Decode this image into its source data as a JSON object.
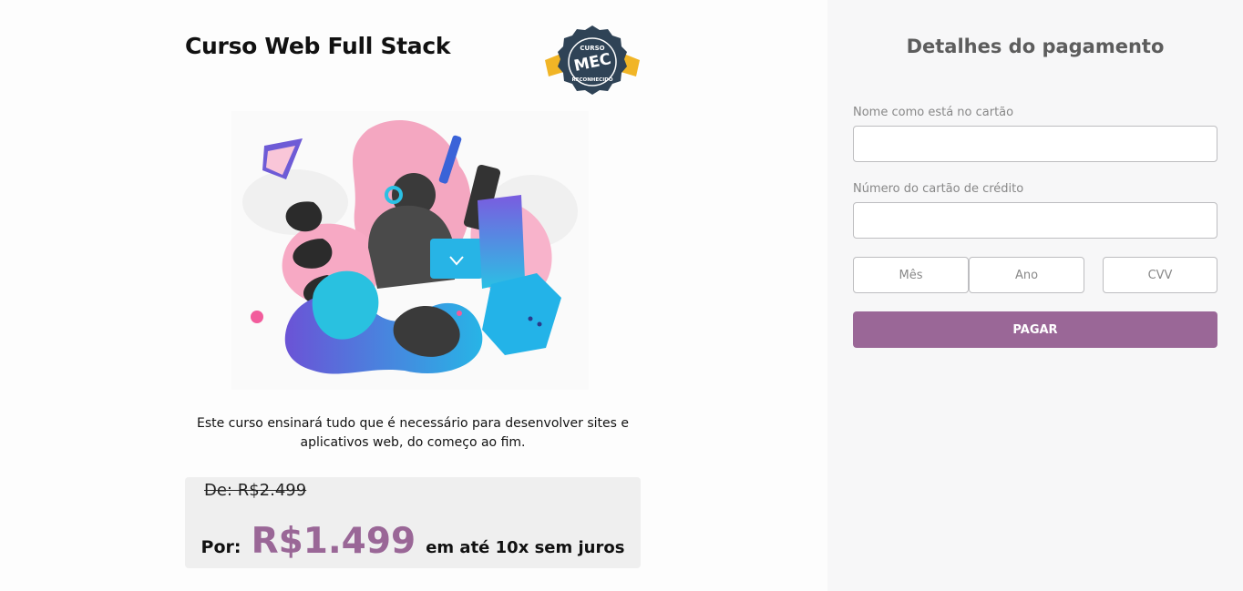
{
  "course": {
    "title": "Curso Web Full Stack",
    "badge_text": "CURSO MEC RECONHECIDO",
    "description": "Este curso ensinará tudo que é necessário para desenvolver sites e aplicativos web, do começo ao fim.",
    "old_price": "De: R$2.499",
    "por_label": "Por:",
    "price": "R$1.499",
    "installments": "em até 10x sem juros"
  },
  "payment": {
    "title": "Detalhes do pagamento",
    "name_label": "Nome como está no cartão",
    "name_value": "",
    "card_label": "Número do cartão de crédito",
    "card_value": "",
    "month_placeholder": "Mês",
    "year_placeholder": "Ano",
    "cvv_placeholder": "CVV",
    "pay_button": "PAGAR"
  },
  "colors": {
    "accent": "#9a6797",
    "panel_bg": "#f7f7f8",
    "price_box_bg": "#efefef"
  }
}
